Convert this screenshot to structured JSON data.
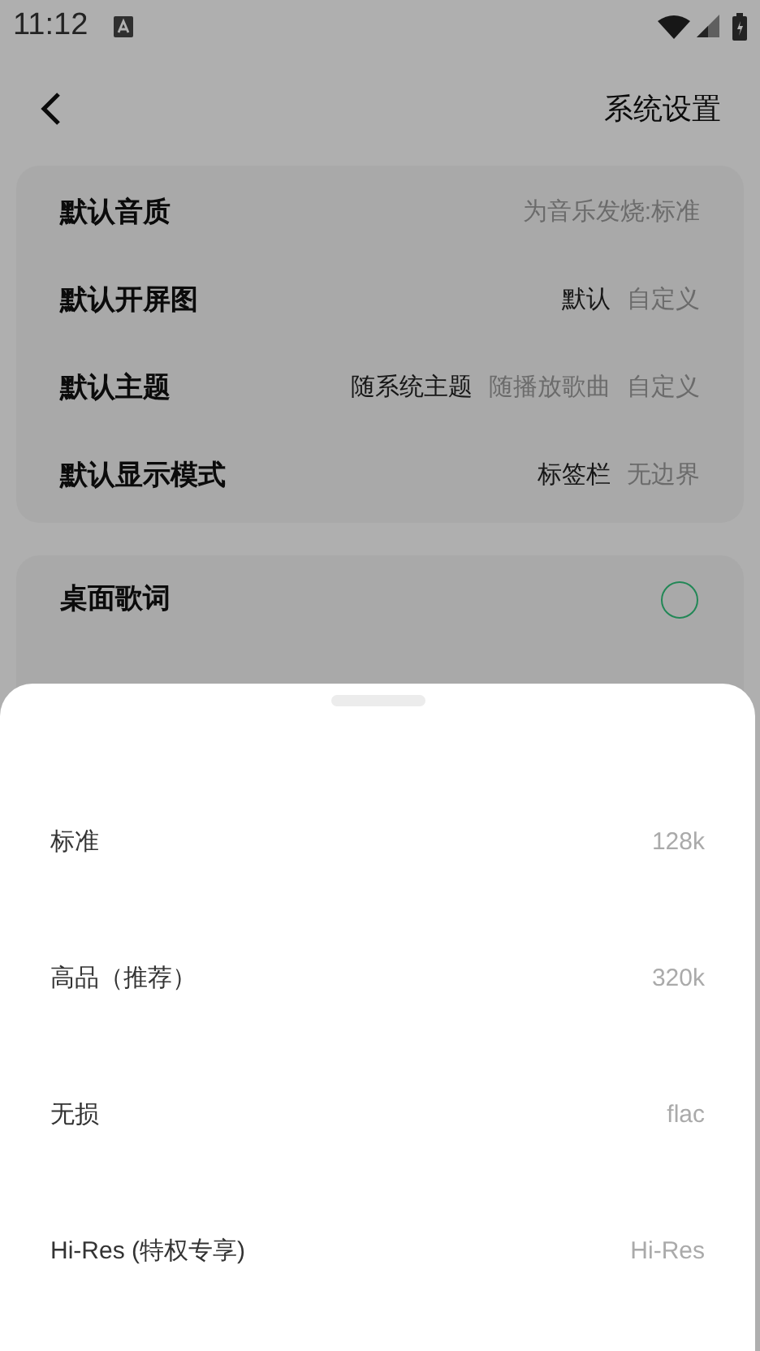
{
  "status_bar": {
    "time": "11:12"
  },
  "header": {
    "title": "系统设置"
  },
  "settings_card": [
    {
      "label": "默认音质",
      "options": [
        {
          "text": "为音乐发烧:标准",
          "selected": false
        }
      ]
    },
    {
      "label": "默认开屏图",
      "options": [
        {
          "text": "默认",
          "selected": true
        },
        {
          "text": "自定义",
          "selected": false
        }
      ]
    },
    {
      "label": "默认主题",
      "options": [
        {
          "text": "随系统主题",
          "selected": true
        },
        {
          "text": "随播放歌曲",
          "selected": false
        },
        {
          "text": "自定义",
          "selected": false
        }
      ]
    },
    {
      "label": "默认显示模式",
      "options": [
        {
          "text": "标签栏",
          "selected": true
        },
        {
          "text": "无边界",
          "selected": false
        }
      ]
    }
  ],
  "toggle_card": [
    {
      "label": "桌面歌词",
      "on": false
    }
  ],
  "quality_sheet": {
    "items": [
      {
        "label": "标准",
        "value": "128k"
      },
      {
        "label": "高品（推荐）",
        "value": "320k"
      },
      {
        "label": "无损",
        "value": "flac"
      },
      {
        "label": "Hi-Res (特权专享)",
        "value": "Hi-Res"
      }
    ]
  }
}
